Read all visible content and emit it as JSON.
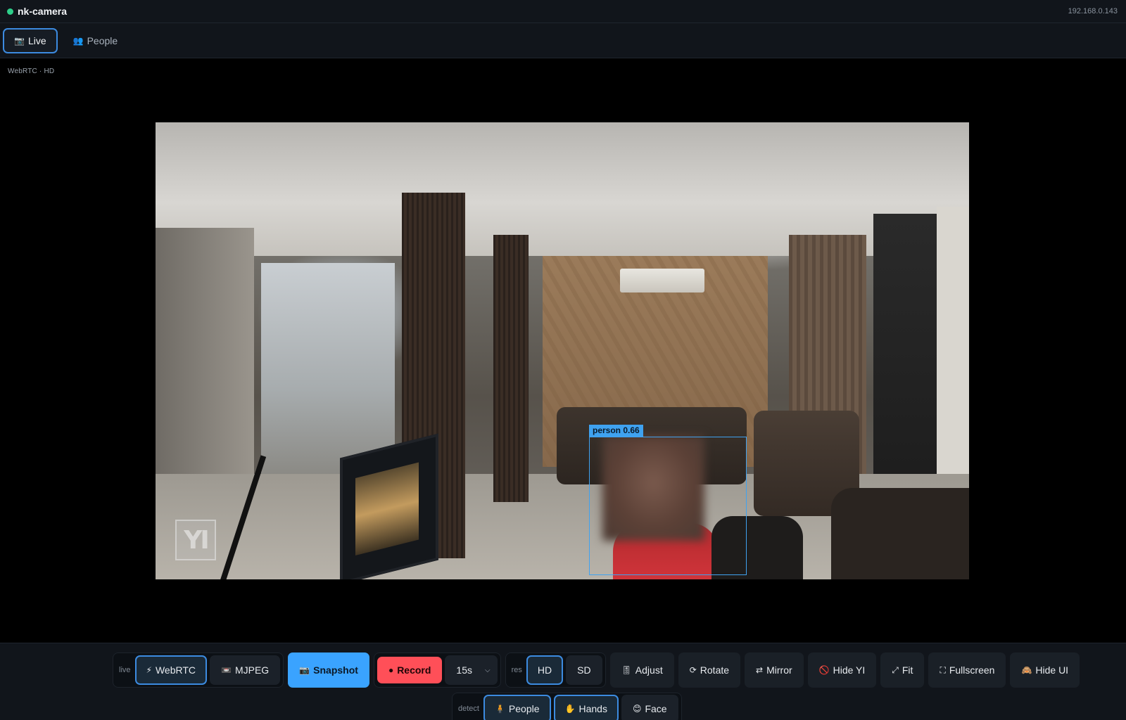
{
  "app": {
    "title": "nk-camera",
    "ip": "192.168.0.143",
    "status_color": "#2ecf8a"
  },
  "tabs": [
    {
      "label": "Live",
      "icon": "camera-icon",
      "glyph": "📷",
      "active": true
    },
    {
      "label": "People",
      "icon": "people-icon",
      "glyph": "👥",
      "active": false
    }
  ],
  "stream": {
    "label": "WebRTC · HD"
  },
  "video": {
    "watermark": "YI",
    "detection": {
      "label": "person 0.66",
      "color": "#3fa2f0"
    }
  },
  "controls": {
    "live_group": {
      "label": "live",
      "webrtc": {
        "label": "WebRTC",
        "glyph": "⚡",
        "selected": true
      },
      "mjpeg": {
        "label": "MJPEG",
        "glyph": "📼",
        "selected": false
      }
    },
    "snapshot": {
      "label": "Snapshot",
      "glyph": "📷"
    },
    "record": {
      "label": "Record",
      "glyph": "●"
    },
    "duration": {
      "value": "15s"
    },
    "res_group": {
      "label": "res",
      "hd": {
        "label": "HD",
        "selected": true
      },
      "sd": {
        "label": "SD",
        "selected": false
      }
    },
    "adjust": {
      "label": "Adjust",
      "glyph": "🎚"
    },
    "rotate": {
      "label": "Rotate",
      "glyph": "⟳"
    },
    "mirror": {
      "label": "Mirror",
      "glyph": "⇄"
    },
    "hide_yi": {
      "label": "Hide YI",
      "glyph": "🚫"
    },
    "fit": {
      "label": "Fit",
      "glyph": "⤢"
    },
    "fullscreen": {
      "label": "Fullscreen",
      "glyph": "⛶"
    },
    "hide_ui": {
      "label": "Hide UI",
      "glyph": "🙈"
    },
    "detect_group": {
      "label": "detect",
      "people": {
        "label": "People",
        "glyph": "🧍",
        "selected": true
      },
      "hands": {
        "label": "Hands",
        "glyph": "✋",
        "selected": true
      },
      "face": {
        "label": "Face",
        "glyph": "😊",
        "selected": false
      }
    }
  },
  "colors": {
    "accent": "#3c8be0",
    "snapshot": "#3aa3ff",
    "record": "#ff4f58"
  }
}
